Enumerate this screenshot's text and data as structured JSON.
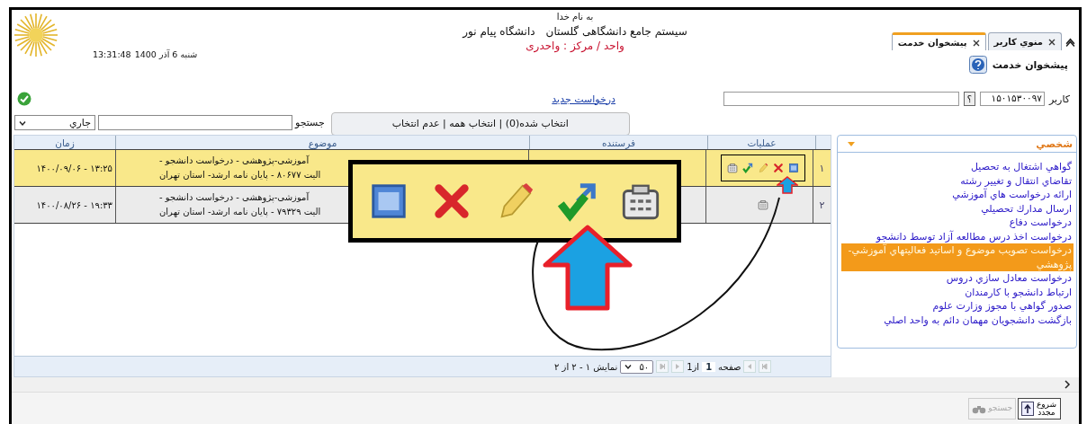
{
  "header": {
    "motto": "به نام خدا",
    "system_name": "سیستم جامع دانشگاهی گلستان",
    "university": "دانشگاه پیام نور",
    "unit": "واحد / مرکز : واحدری",
    "clock": "13:31:48",
    "date": "شنبه 6 آذر 1400"
  },
  "tabs": [
    {
      "label": "منوي کاربر",
      "selected": false
    },
    {
      "label": "پيشخوان خدمت",
      "selected": true
    }
  ],
  "page_title": "پيشخوان خدمت",
  "new_request_link": "درخواست جديد",
  "user_field": {
    "label": "کاربر",
    "value": "۱۵۰۱۵۳۰۰۹۷",
    "lookup_button": "؟"
  },
  "filter": {
    "status": "جاري",
    "search_label": "جستجو",
    "selection": "انتخاب شده(0) | انتخاب همه | عدم انتخاب"
  },
  "table": {
    "columns": [
      "عمليات",
      "فرستنده",
      "موضوع",
      "زمان"
    ],
    "rows": [
      {
        "number": "۱",
        "time": "۱۳:۲۵ - ۱۴۰۰/۰۹/۰۶",
        "subject": [
          "آموزشی-پژوهشی - درخواست دانشجو -",
          "الیت ۸۰۶۷۷ - پایان نامه ارشد- استان تهران"
        ],
        "selected": true,
        "actions": [
          {
            "kind": "view"
          },
          {
            "kind": "delete"
          },
          {
            "kind": "edit"
          },
          {
            "kind": "approve"
          },
          {
            "kind": "form"
          }
        ]
      },
      {
        "number": "۲",
        "time": "۱۹:۳۳ - ۱۴۰۰/۰۸/۲۶",
        "subject": [
          "آموزشی-پژوهشی - درخواست دانشجو -",
          "الیت ۷۹۳۲۹ - پایان نامه ارشد- استان تهران"
        ],
        "selected": false,
        "actions": [
          {
            "kind": "form"
          }
        ]
      }
    ]
  },
  "pager": {
    "page_label": "صفحه",
    "page": "1",
    "of": "از1",
    "page_size": "۵۰",
    "summary": "نمايش ۱ - ۲ از ۲"
  },
  "sidebar": {
    "title": "شخصي",
    "expanded": true,
    "items": [
      {
        "label": "گواهي اشتغال به تحصيل",
        "selected": false
      },
      {
        "label": "تقاضاي انتقال و تغيير رشته",
        "selected": false
      },
      {
        "label": "ارائه درخواست هاي آموزشي",
        "selected": false
      },
      {
        "label": "ارسال مدارك تحصيلي",
        "selected": false
      },
      {
        "label": "درخواست دفاع",
        "selected": false
      },
      {
        "label": "درخواست اخذ درس مطالعه آزاد توسط دانشجو",
        "selected": false
      },
      {
        "label": "درخواست تصويب موضوع و اساتيد فعاليتهاي آموزشي-پژوهشي",
        "selected": true
      },
      {
        "label": "درخواست معادل سازي دروس",
        "selected": false
      },
      {
        "label": "ارتباط دانشجو با كارمندان",
        "selected": false
      },
      {
        "label": "صدور گواهي با مجوز وزارت علوم",
        "selected": false
      },
      {
        "label": "بازگشت دانشجويان مهمان دائم به واحد اصلي",
        "selected": false
      }
    ]
  },
  "footer_buttons": [
    {
      "label": "شروع مجدد",
      "disabled": false
    },
    {
      "label": "جستجو",
      "disabled": true
    }
  ]
}
